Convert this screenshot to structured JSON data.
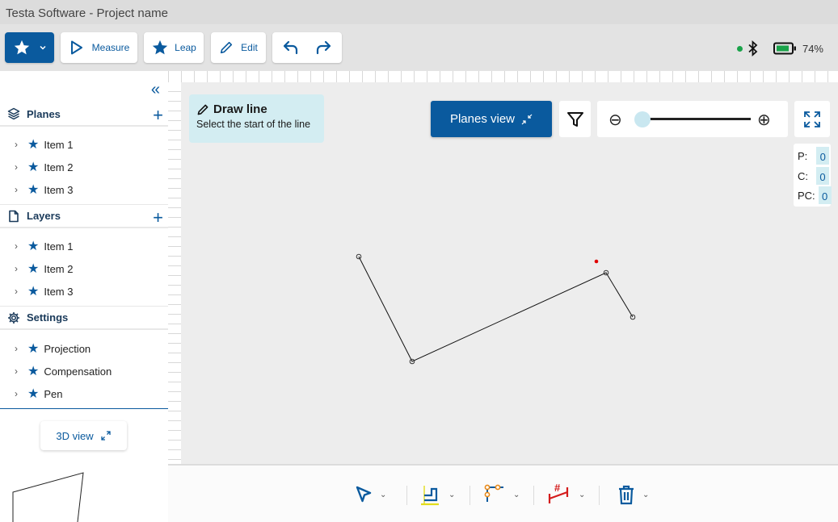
{
  "window": {
    "title": "Testa Software - Project name"
  },
  "toolbar": {
    "measure_label": "Measure",
    "leap_label": "Leap",
    "edit_label": "Edit",
    "battery": "74%"
  },
  "sidebar": {
    "planes": {
      "title": "Planes",
      "items": [
        "Item 1",
        "Item 2",
        "Item 3"
      ]
    },
    "layers": {
      "title": "Layers",
      "items": [
        "Item 1",
        "Item 2",
        "Item 3"
      ]
    },
    "settings": {
      "title": "Settings",
      "items": [
        "Projection",
        "Compensation",
        "Pen"
      ]
    },
    "view3d_label": "3D view"
  },
  "canvas": {
    "hint_title": "Draw line",
    "hint_text": "Select the start of the line",
    "planes_view_label": "Planes view",
    "counters": [
      {
        "label": "P:",
        "value": "0"
      },
      {
        "label": "C:",
        "value": "0"
      },
      {
        "label": "PC:",
        "value": "0"
      }
    ]
  },
  "colors": {
    "accent": "#0a5a9e",
    "hint_bg": "#d3edf2",
    "status_green": "#1aa34a",
    "marker_red": "#e00000"
  },
  "icons": [
    "star-icon",
    "play-icon",
    "pencil-icon",
    "undo-icon",
    "redo-icon",
    "bluetooth-icon",
    "battery-icon",
    "collapse-icon",
    "filter-icon",
    "zoom-out-icon",
    "zoom-in-icon",
    "fullscreen-icon",
    "select-arrow-icon",
    "corner-tool-icon",
    "node-tool-icon",
    "dimension-tool-icon",
    "trash-icon"
  ]
}
